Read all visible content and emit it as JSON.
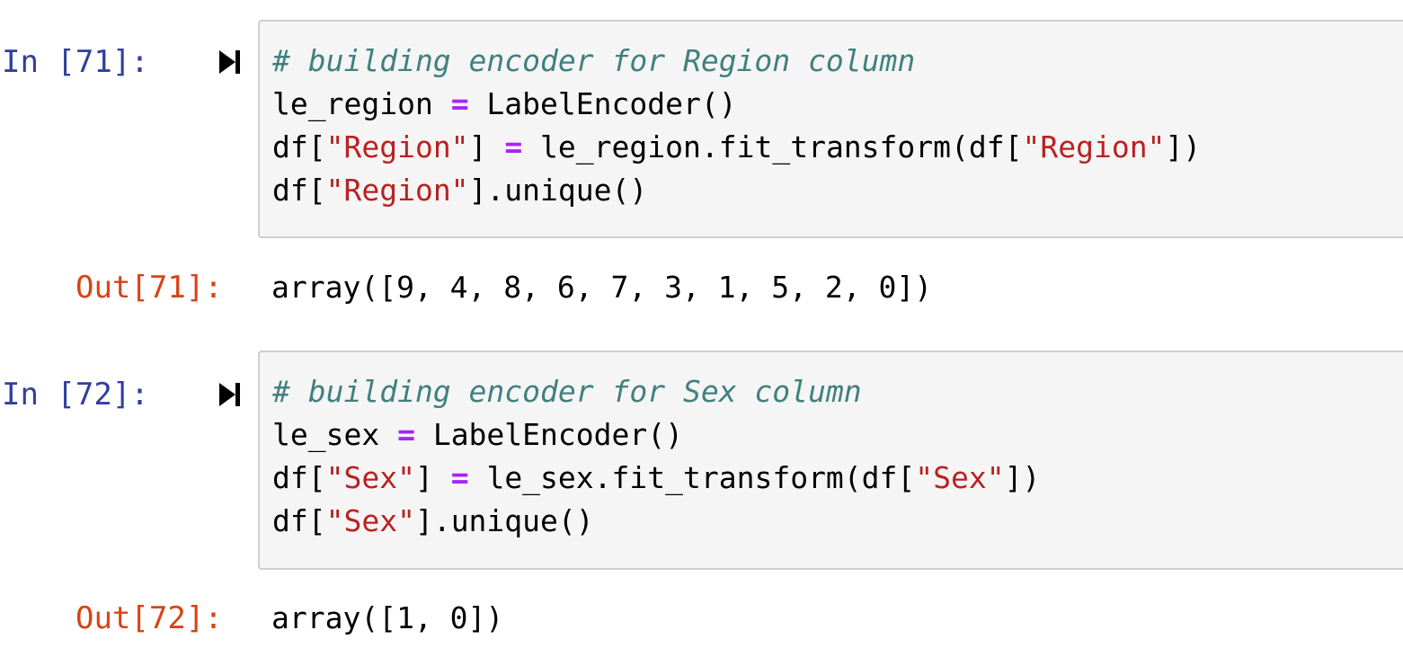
{
  "cells": [
    {
      "in_prompt": "In [71]:",
      "code": {
        "comment": "# building encoder for Region column",
        "line2": {
          "var": "le_region ",
          "op": "=",
          "rest": " LabelEncoder()"
        },
        "line3": {
          "p1": "df[",
          "s1": "\"Region\"",
          "p2": "] ",
          "op": "=",
          "p3": " le_region.fit_transform(df[",
          "s2": "\"Region\"",
          "p4": "])"
        },
        "line4": {
          "p1": "df[",
          "s1": "\"Region\"",
          "p2": "].unique()"
        }
      },
      "out_prompt": "Out[71]:",
      "output": "array([9, 4, 8, 6, 7, 3, 1, 5, 2, 0])"
    },
    {
      "in_prompt": "In [72]:",
      "code": {
        "comment": "# building encoder for Sex column",
        "line2": {
          "var": "le_sex ",
          "op": "=",
          "rest": " LabelEncoder()"
        },
        "line3": {
          "p1": "df[",
          "s1": "\"Sex\"",
          "p2": "] ",
          "op": "=",
          "p3": " le_sex.fit_transform(df[",
          "s2": "\"Sex\"",
          "p4": "])"
        },
        "line4": {
          "p1": "df[",
          "s1": "\"Sex\"",
          "p2": "].unique()"
        }
      },
      "out_prompt": "Out[72]:",
      "output": "array([1, 0])"
    }
  ],
  "icons": {
    "run": "run-cell-icon"
  },
  "colors": {
    "in_prompt": "#303f9f",
    "out_prompt": "#d84315",
    "comment": "#408080",
    "operator": "#aa22ff",
    "string": "#ba2121",
    "cell_background": "#f5f5f5",
    "cell_border": "#cfcfcf"
  }
}
